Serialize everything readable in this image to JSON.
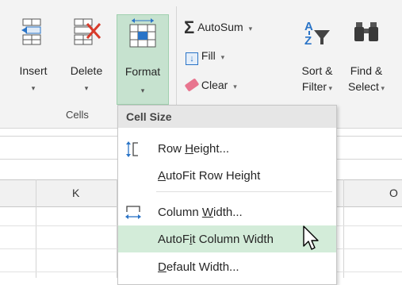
{
  "ribbon": {
    "cells_group": {
      "label": "Cells",
      "insert_label": "Insert",
      "delete_label": "Delete",
      "format_label": "Format"
    },
    "editing": {
      "autosum_label": "AutoSum",
      "fill_label": "Fill",
      "clear_label": "Clear",
      "sort_label_1": "Sort &",
      "sort_label_2": "Filter",
      "find_label_1": "Find &",
      "find_label_2": "Select"
    }
  },
  "sheet": {
    "columns": [
      "K",
      "O"
    ]
  },
  "menu": {
    "header": "Cell Size",
    "items": [
      {
        "pre": "Row ",
        "ul": "H",
        "post": "eight...",
        "icon": "row-height-icon"
      },
      {
        "pre": "",
        "ul": "A",
        "post": "utoFit Row Height",
        "icon": ""
      },
      {
        "pre": "Column ",
        "ul": "W",
        "post": "idth...",
        "icon": "column-width-icon"
      },
      {
        "pre": "AutoF",
        "ul": "i",
        "post": "t Column Width",
        "icon": ""
      },
      {
        "pre": "",
        "ul": "D",
        "post": "efault Width...",
        "icon": ""
      }
    ]
  },
  "colors": {
    "highlight": "#d3ecd9",
    "format_button_bg": "#c6e2cf",
    "accent_blue": "#2a74c7",
    "delete_red": "#d83b2b"
  }
}
